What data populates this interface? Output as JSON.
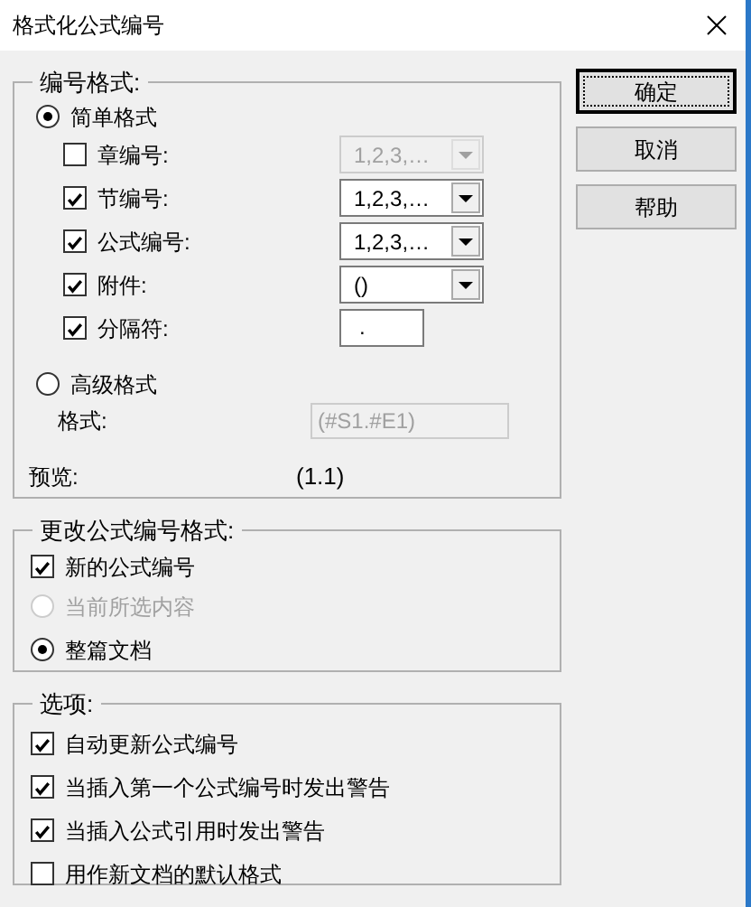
{
  "window": {
    "title": "格式化公式编号"
  },
  "numbering_format": {
    "legend": "编号格式:",
    "simple": {
      "label": "简单格式",
      "selected": true
    },
    "items": [
      {
        "label": "章编号:",
        "checked": false,
        "kind": "dropdown",
        "value": "1,2,3,…",
        "disabled": true
      },
      {
        "label": "节编号:",
        "checked": true,
        "kind": "dropdown",
        "value": "1,2,3,…",
        "disabled": false
      },
      {
        "label": "公式编号:",
        "checked": true,
        "kind": "dropdown",
        "value": "1,2,3,…",
        "disabled": false
      },
      {
        "label": "附件:",
        "checked": true,
        "kind": "dropdown",
        "value": "()",
        "disabled": false
      },
      {
        "label": "分隔符:",
        "checked": true,
        "kind": "text",
        "value": "."
      }
    ],
    "advanced": {
      "label": "高级格式",
      "selected": false
    },
    "format": {
      "label": "格式:",
      "value": "(#S1.#E1)",
      "disabled": true
    },
    "preview": {
      "label": "预览:",
      "value": "(1.1)"
    }
  },
  "change_format": {
    "legend": "更改公式编号格式:",
    "new_number": {
      "label": "新的公式编号",
      "checked": true
    },
    "scope": [
      {
        "label": "当前所选内容",
        "selected": false,
        "disabled": true
      },
      {
        "label": "整篇文档",
        "selected": true,
        "disabled": false
      }
    ]
  },
  "options": {
    "legend": "选项:",
    "items": [
      {
        "label": "自动更新公式编号",
        "checked": true
      },
      {
        "label": "当插入第一个公式编号时发出警告",
        "checked": true
      },
      {
        "label": "当插入公式引用时发出警告",
        "checked": true
      },
      {
        "label": "用作新文档的默认格式",
        "checked": false
      }
    ]
  },
  "buttons": [
    {
      "label": "确定",
      "default": true
    },
    {
      "label": "取消",
      "default": false
    },
    {
      "label": "帮助",
      "default": false
    }
  ]
}
